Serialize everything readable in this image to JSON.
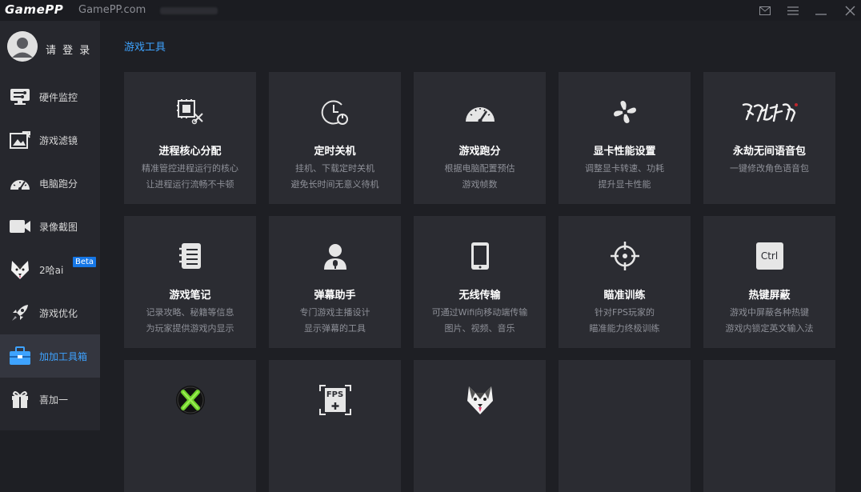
{
  "app": {
    "logo": "GamePP",
    "site": "GamePP.com"
  },
  "user": {
    "login_label": "请 登 录"
  },
  "sidebar": {
    "items": [
      {
        "label": "硬件监控",
        "icon": "hardware-monitor-icon"
      },
      {
        "label": "游戏滤镜",
        "icon": "game-filter-icon"
      },
      {
        "label": "电脑跑分",
        "icon": "speedometer-icon"
      },
      {
        "label": "录像截图",
        "icon": "video-camera-icon"
      },
      {
        "label": "2哈ai",
        "icon": "husky-icon",
        "badge": "Beta"
      },
      {
        "label": "游戏优化",
        "icon": "rocket-icon"
      },
      {
        "label": "加加工具箱",
        "icon": "toolbox-icon",
        "active": true
      },
      {
        "label": "喜加一",
        "icon": "gift-icon"
      }
    ]
  },
  "main": {
    "section_title": "游戏工具",
    "cards": [
      {
        "title": "进程核心分配",
        "desc1": "精准管控进程运行的核心",
        "desc2": "让进程运行流畅不卡顿",
        "icon": "cpu-core-icon"
      },
      {
        "title": "定时关机",
        "desc1": "挂机、下载定时关机",
        "desc2": "避免长时间无意义待机",
        "icon": "timer-power-icon"
      },
      {
        "title": "游戏跑分",
        "desc1": "根据电脑配置预估",
        "desc2": "游戏帧数",
        "icon": "gauge-icon"
      },
      {
        "title": "显卡性能设置",
        "desc1": "调整显卡转速、功耗",
        "desc2": "提升显卡性能",
        "icon": "fan-icon"
      },
      {
        "title": "永劫无间语音包",
        "desc1": "一键修改角色语音包",
        "desc2": "",
        "icon": "naraka-logo-icon"
      },
      {
        "title": "游戏笔记",
        "desc1": "记录攻略、秘籍等信息",
        "desc2": "为玩家提供游戏内显示",
        "icon": "notebook-icon"
      },
      {
        "title": "弹幕助手",
        "desc1": "专门游戏主播设计",
        "desc2": "显示弹幕的工具",
        "icon": "streamer-icon"
      },
      {
        "title": "无线传输",
        "desc1": "可通过Wifi向移动端传输",
        "desc2": "图片、视频、音乐",
        "icon": "phone-icon"
      },
      {
        "title": "瞄准训练",
        "desc1": "针对FPS玩家的",
        "desc2": "瞄准能力终极训练",
        "icon": "crosshair-icon"
      },
      {
        "title": "热键屏蔽",
        "desc1": "游戏中屏蔽各种热键",
        "desc2": "游戏内锁定英文输入法",
        "icon": "ctrl-key-icon",
        "key_label": "Ctrl"
      },
      {
        "title": "",
        "desc1": "",
        "desc2": "",
        "icon": "xbox-logo-icon"
      },
      {
        "title": "",
        "desc1": "",
        "desc2": "",
        "icon": "fps-plus-icon",
        "key_label": "FPS"
      },
      {
        "title": "",
        "desc1": "",
        "desc2": "",
        "icon": "husky-face-icon"
      },
      {
        "title": "",
        "desc1": "",
        "desc2": "",
        "icon": ""
      },
      {
        "title": "",
        "desc1": "",
        "desc2": "",
        "icon": ""
      }
    ]
  },
  "colors": {
    "accent": "#3ea3ff",
    "card_bg": "#2b2c32",
    "sidebar_bg": "#26272d",
    "main_bg": "#1e1f24",
    "beta": "#1677e6"
  }
}
